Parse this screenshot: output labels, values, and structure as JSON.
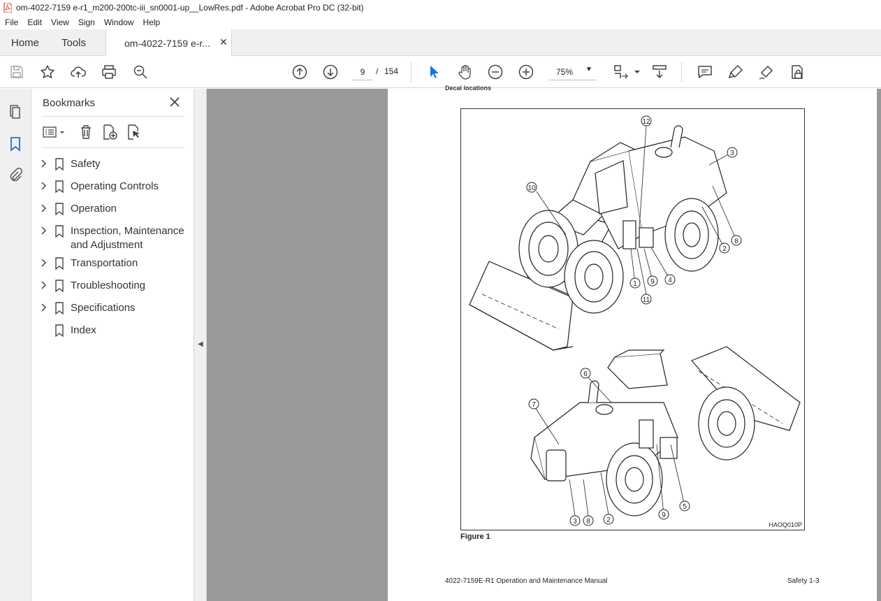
{
  "window": {
    "title": "om-4022-7159 e-r1_m200-200tc-iii_sn0001-up__LowRes.pdf - Adobe Acrobat Pro DC (32-bit)"
  },
  "menu": [
    "File",
    "Edit",
    "View",
    "Sign",
    "Window",
    "Help"
  ],
  "tabs": {
    "home": "Home",
    "tools": "Tools",
    "document": "om-4022-7159 e-r..."
  },
  "toolbar": {
    "page_current": "9",
    "page_separator": "/",
    "page_total": "154",
    "zoom": "75%"
  },
  "bookmarks_panel": {
    "title": "Bookmarks",
    "items": [
      {
        "label": "Safety",
        "expandable": true
      },
      {
        "label": "Operating Controls",
        "expandable": true
      },
      {
        "label": "Operation",
        "expandable": true
      },
      {
        "label": "Inspection, Maintenance and Adjustment",
        "expandable": true
      },
      {
        "label": "Transportation",
        "expandable": true
      },
      {
        "label": "Troubleshooting",
        "expandable": true
      },
      {
        "label": "Specifications",
        "expandable": true
      },
      {
        "label": "Index",
        "expandable": false
      }
    ]
  },
  "document_page": {
    "cut_heading": "Decal locations",
    "figure_id": "HAOQ010P",
    "figure_caption": "Figure 1",
    "callouts_top": [
      "12",
      "3",
      "10",
      "8",
      "2",
      "4",
      "9",
      "1",
      "11"
    ],
    "callouts_bottom": [
      "6",
      "7",
      "5",
      "9",
      "3",
      "8",
      "2"
    ],
    "footer_left": "4022-7159E-R1 Operation and Maintenance Manual",
    "footer_right": "Safety 1-3"
  },
  "icons": {
    "save": "save-icon",
    "bookmark_star": "star-icon",
    "upload": "cloud-upload-icon",
    "print": "print-icon",
    "zoom_search": "zoom-search-icon",
    "prev_page": "arrow-up-circle-icon",
    "next_page": "arrow-down-circle-icon",
    "select": "pointer-icon",
    "hand": "hand-icon",
    "zoom_out": "zoom-out-icon",
    "zoom_in": "zoom-in-icon",
    "fit": "fit-page-icon",
    "scroll": "scroll-mode-icon",
    "comment": "comment-icon",
    "highlight": "highlight-icon",
    "sign": "sign-icon",
    "protect": "protect-icon"
  },
  "colors": {
    "accent": "#1473e6",
    "pdf_red": "#e0251b",
    "canvas_gray": "#999999"
  }
}
